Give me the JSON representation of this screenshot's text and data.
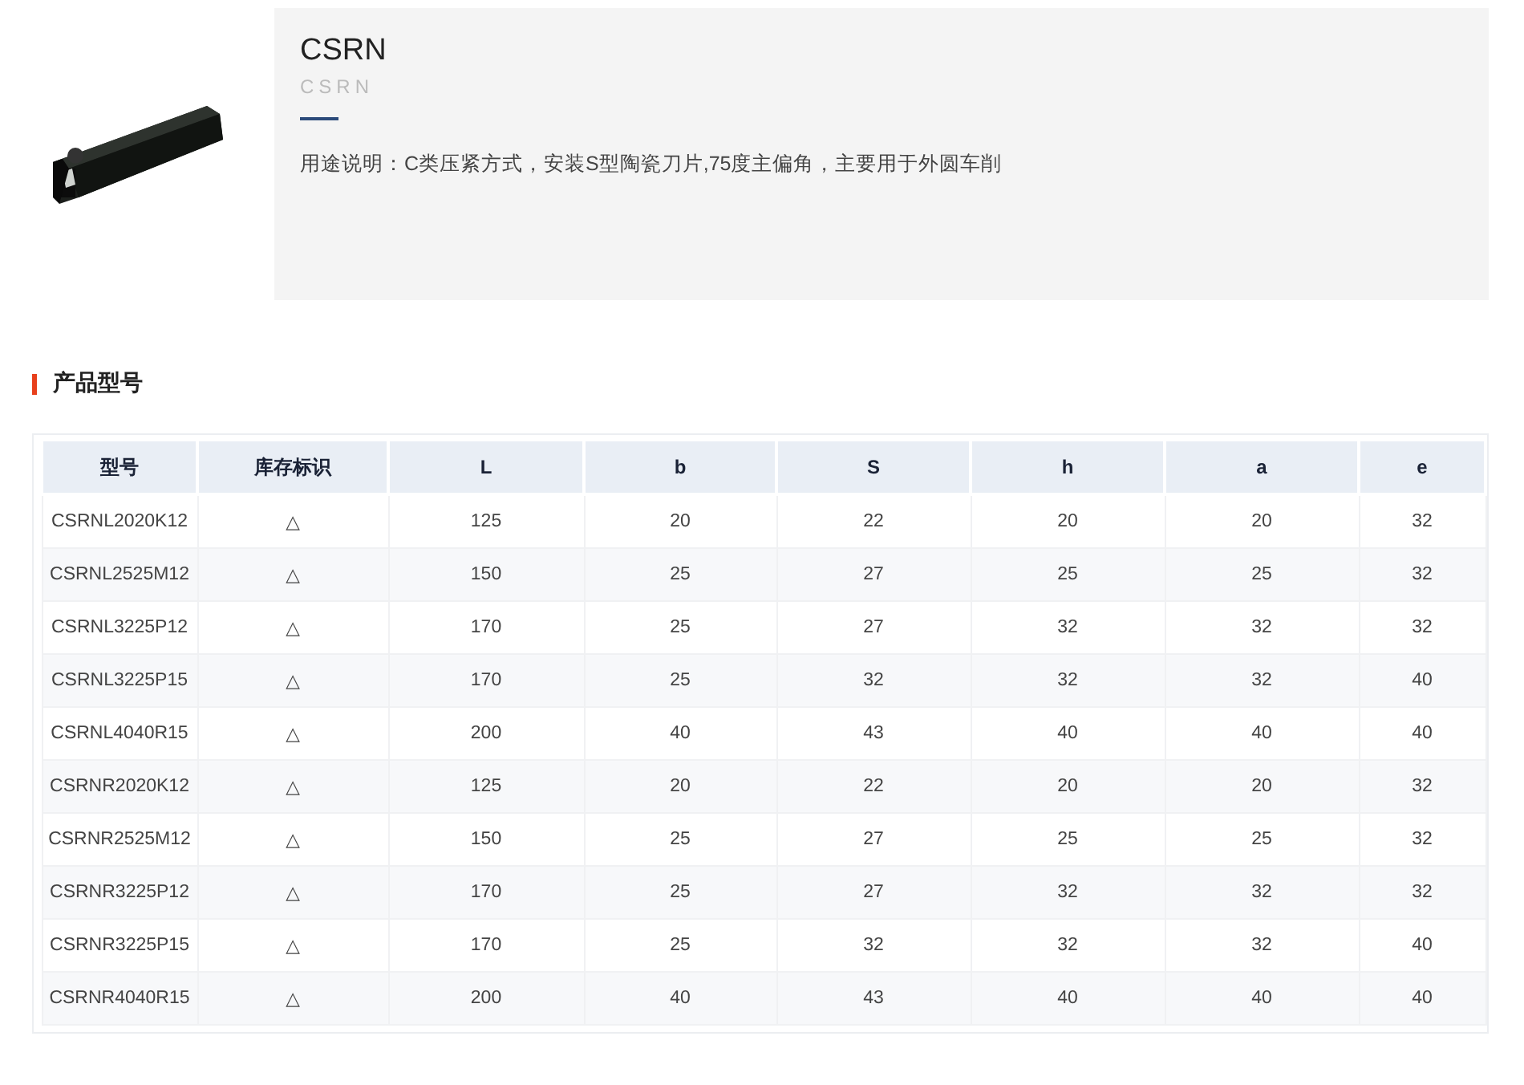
{
  "product": {
    "kind": "picture",
    "title": "CSRN",
    "subtitle": "CSRN",
    "description": "用途说明：C类压紧方式，安装S型陶瓷刀片,75度主偏角，主要用于外圆车削"
  },
  "section_title": "产品型号",
  "table": {
    "columns": [
      "型号",
      "库存标识",
      "L",
      "b",
      "S",
      "h",
      "a",
      "e"
    ],
    "rows": [
      [
        "CSRNL2020K12",
        "△",
        "125",
        "20",
        "22",
        "20",
        "20",
        "32"
      ],
      [
        "CSRNL2525M12",
        "△",
        "150",
        "25",
        "27",
        "25",
        "25",
        "32"
      ],
      [
        "CSRNL3225P12",
        "△",
        "170",
        "25",
        "27",
        "32",
        "32",
        "32"
      ],
      [
        "CSRNL3225P15",
        "△",
        "170",
        "25",
        "32",
        "32",
        "32",
        "40"
      ],
      [
        "CSRNL4040R15",
        "△",
        "200",
        "40",
        "43",
        "40",
        "40",
        "40"
      ],
      [
        "CSRNR2020K12",
        "△",
        "125",
        "20",
        "22",
        "20",
        "20",
        "32"
      ],
      [
        "CSRNR2525M12",
        "△",
        "150",
        "25",
        "27",
        "25",
        "25",
        "32"
      ],
      [
        "CSRNR3225P12",
        "△",
        "170",
        "25",
        "27",
        "32",
        "32",
        "32"
      ],
      [
        "CSRNR3225P15",
        "△",
        "170",
        "25",
        "32",
        "32",
        "32",
        "40"
      ],
      [
        "CSRNR4040R15",
        "△",
        "200",
        "40",
        "43",
        "40",
        "40",
        "40"
      ]
    ]
  }
}
